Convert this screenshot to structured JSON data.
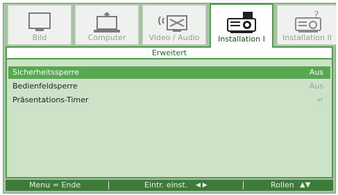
{
  "tabs": [
    {
      "label": "Bild",
      "icon": "monitor-icon",
      "active": false
    },
    {
      "label": "Computer",
      "icon": "computer-icon",
      "active": false
    },
    {
      "label": "Video / Audio",
      "icon": "video-audio-icon",
      "active": false
    },
    {
      "label": "Installation I",
      "icon": "projector-icon",
      "active": true
    },
    {
      "label": "Installation II",
      "icon": "projector-question-icon",
      "active": false
    }
  ],
  "submenu_title": "Erweitert",
  "items": [
    {
      "label": "Sicherheitssperre",
      "value": "Aus",
      "selected": true
    },
    {
      "label": "Bedienfeldsperre",
      "value": "Aus",
      "selected": false
    },
    {
      "label": "Präsentations-Timer",
      "value": "↵",
      "selected": false
    }
  ],
  "footer": {
    "exit": "Menu = Ende",
    "enter": "Eintr. einst.",
    "enter_arrows": "◀ ▶",
    "scroll": "Rollen",
    "scroll_arrows": "▲▼"
  },
  "colors": {
    "accent": "#4f9e4c",
    "selected_row": "#57a851",
    "panel": "#cde3c8",
    "footer": "#3f7a3b"
  }
}
